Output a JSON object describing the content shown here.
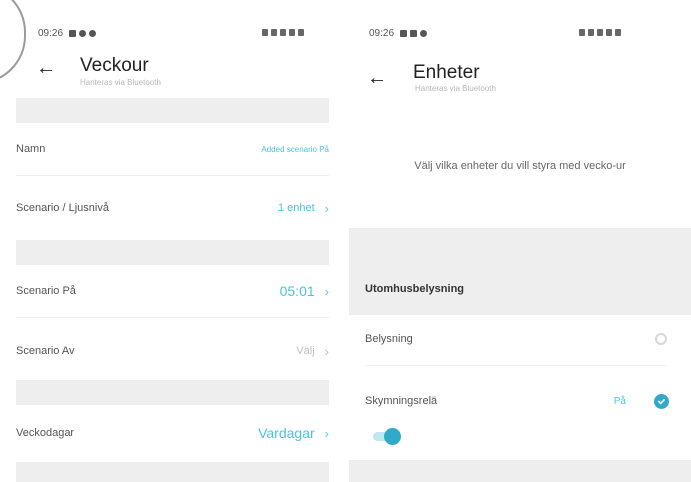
{
  "left": {
    "status": {
      "time": "09:26"
    },
    "title": "Veckour",
    "subtitle": "Hanteras via Bluetooth",
    "rows": [
      {
        "label": "Namn",
        "value": "Added scenario På"
      },
      {
        "label": "Scenario / Ljusnivå",
        "value": "1 enhet"
      },
      {
        "label": "Scenario På",
        "value": "05:01"
      },
      {
        "label": "Scenario Av",
        "value": "Välj"
      },
      {
        "label": "Veckodagar",
        "value": "Vardagar"
      }
    ]
  },
  "right": {
    "status": {
      "time": "09:26"
    },
    "title": "Enheter",
    "subtitle": "Hanteras via Bluetooth",
    "info": "Välj vilka enheter du vill styra med vecko-ur",
    "section": "Utomhusbelysning",
    "devices": [
      {
        "label": "Belysning",
        "selected": false
      },
      {
        "label": "Skymningsrelä",
        "selected": true,
        "state": "På"
      }
    ]
  },
  "colors": {
    "accent": "#4cc4dc",
    "check": "#32a9c9",
    "band": "#eeeeee"
  }
}
